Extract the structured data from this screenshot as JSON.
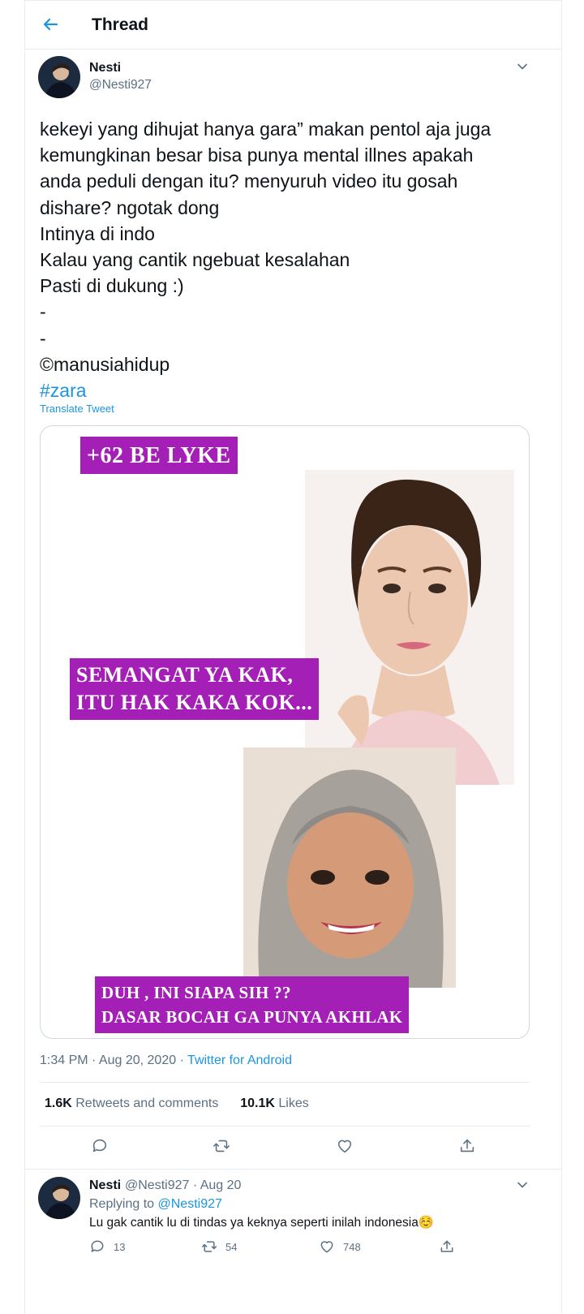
{
  "header": {
    "title": "Thread",
    "back_icon": "arrow-left-icon"
  },
  "tweet": {
    "author_name": "Nesti",
    "author_handle": "@Nesti927",
    "text_lines": [
      "kekeyi yang dihujat hanya gara” makan pentol aja juga",
      "kemungkinan besar bisa punya mental illnes apakah",
      "anda peduli dengan itu? menyuruh video itu gosah",
      "dishare? ngotak dong",
      "Intinya di indo",
      "Kalau yang cantik ngebuat kesalahan",
      "Pasti di dukung :)",
      "-",
      "-",
      "©manusiahidup"
    ],
    "hashtag": "#zara",
    "translate_label": "Translate Tweet",
    "meme": {
      "label_top": "+62 BE LYKE",
      "label_middle_1": "SEMANGAT YA KAK,",
      "label_middle_2": "ITU HAK KAKA KOK...",
      "label_bottom_1": "DUH , INI SIAPA SIH ??",
      "label_bottom_2": "DASAR BOCAH GA PUNYA AKHLAK"
    },
    "time": "1:34 PM · Aug 20, 2020 · ",
    "source": "Twitter for Android",
    "retweets_count": "1.6K",
    "retweets_label": "Retweets and comments",
    "likes_count": "10.1K",
    "likes_label": "Likes"
  },
  "reply": {
    "author_name": "Nesti",
    "meta": "@Nesti927 · Aug 20",
    "replying_prefix": "Replying to ",
    "replying_handle": "@Nesti927",
    "text": "Lu gak cantik lu di tindas ya keknya seperti inilah indonesia☺️",
    "reply_count": "13",
    "retweet_count": "54",
    "like_count": "748"
  },
  "colors": {
    "accent": "#1b95e0",
    "meme_purple": "#a41fb5",
    "muted": "#5b7083"
  }
}
